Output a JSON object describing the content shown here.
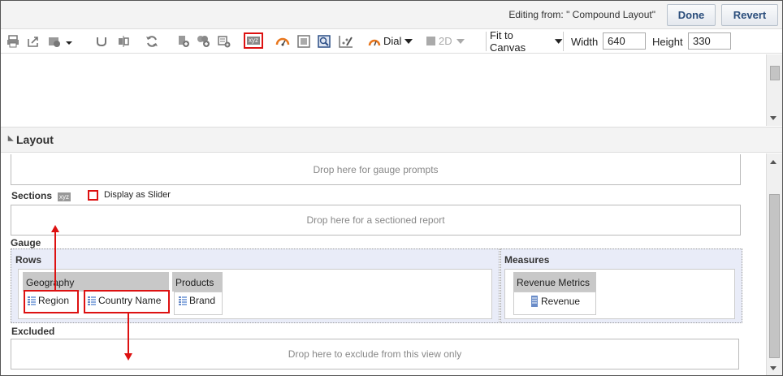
{
  "header": {
    "editing_text": "Editing from: \" Compound Layout\"",
    "done_label": "Done",
    "revert_label": "Revert"
  },
  "toolbar": {
    "icons": [
      "print-icon",
      "export-icon",
      "view-options-icon",
      "undo-icon",
      "swap-icon",
      "refresh-icon",
      "new-calc-icon",
      "new-group-icon",
      "new-item-icon",
      "xyz-icon",
      "gauge-icon",
      "table-icon",
      "zoom-icon",
      "edit-chart-icon"
    ],
    "xyz_label": "xyz",
    "gauge_type": "Dial",
    "dimension_mode": "2D",
    "fit_label": "Fit to Canvas",
    "width_label": "Width",
    "width_value": "640",
    "height_label": "Height",
    "height_value": "330"
  },
  "layout": {
    "title": "Layout",
    "gauge_prompts_drop": "Drop here for gauge prompts",
    "sections_label": "Sections",
    "sections_xyz": "xyz",
    "slider_label": "Display as Slider",
    "sections_drop": "Drop here for a sectioned report",
    "gauge_label": "Gauge",
    "rows_label": "Rows",
    "measures_label": "Measures",
    "geography_header": "Geography",
    "region_label": "Region",
    "country_label": "Country Name",
    "products_header": "Products",
    "brand_label": "Brand",
    "revenue_metrics_header": "Revenue Metrics",
    "revenue_label": "Revenue",
    "excluded_label": "Excluded",
    "excluded_drop": "Drop here to exclude from this view only"
  },
  "colors": {
    "accent_red": "#dd1111",
    "link_blue": "#2a4d7b",
    "drop_area_bg": "#e9ecf8"
  }
}
